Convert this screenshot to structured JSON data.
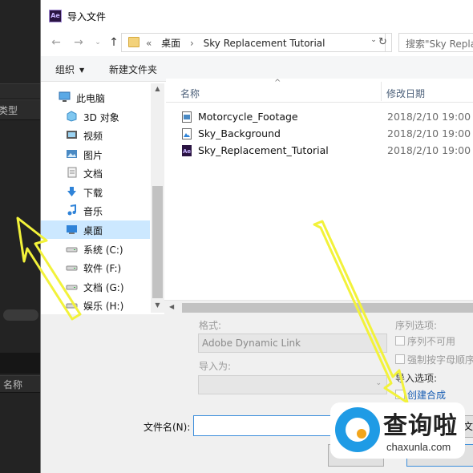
{
  "background_panel": {
    "label_type": "类型",
    "label_name": "名称"
  },
  "dialog": {
    "title": "导入文件",
    "ae_logo": "Ae",
    "address": {
      "prefix": "«",
      "crumb1": "桌面",
      "separator": "›",
      "crumb2": "Sky Replacement Tutorial"
    },
    "search_placeholder": "搜索\"Sky Repla",
    "toolbar": {
      "organize": "组织",
      "new_folder": "新建文件夹"
    },
    "nav_items": [
      {
        "label": "此电脑",
        "icon": "computer-icon"
      },
      {
        "label": "3D 对象",
        "icon": "3d-objects-icon"
      },
      {
        "label": "视频",
        "icon": "video-icon"
      },
      {
        "label": "图片",
        "icon": "pictures-icon"
      },
      {
        "label": "文档",
        "icon": "documents-icon"
      },
      {
        "label": "下载",
        "icon": "download-icon"
      },
      {
        "label": "音乐",
        "icon": "music-icon"
      },
      {
        "label": "桌面",
        "icon": "desktop-icon",
        "selected": true
      },
      {
        "label": "系统 (C:)",
        "icon": "drive-icon"
      },
      {
        "label": "软件 (F:)",
        "icon": "drive-icon"
      },
      {
        "label": "文档 (G:)",
        "icon": "drive-icon"
      },
      {
        "label": "娱乐 (H:)",
        "icon": "drive-icon"
      }
    ],
    "columns": {
      "name": "名称",
      "date": "修改日期"
    },
    "files": [
      {
        "name": "Motorcycle_Footage",
        "date": "2018/2/10 19:00",
        "icon": "video-file-icon"
      },
      {
        "name": "Sky_Background",
        "date": "2018/2/10 19:00",
        "icon": "image-file-icon"
      },
      {
        "name": "Sky_Replacement_Tutorial",
        "date": "2018/2/10 19:00",
        "icon": "ae-project-icon"
      }
    ],
    "options": {
      "format_label": "格式:",
      "format_value": "Adobe Dynamic Link",
      "import_as_label": "导入为:",
      "import_as_value": "",
      "sequence_options_label": "序列选项:",
      "sequence_unavailable": "序列不可用",
      "force_alpha_order": "强制按字母顺序",
      "import_options_label": "导入选项:",
      "create_composition": "创建合成"
    },
    "filename_label": "文件名(N):",
    "filename_value": "",
    "filetype_partial": "文"
  },
  "watermark": {
    "chinese": "查询啦",
    "domain": "chaxunla.com"
  },
  "colors": {
    "annotation": "#f2f23a",
    "selection": "#cce8ff",
    "accent_blue": "#1a5fb4"
  }
}
